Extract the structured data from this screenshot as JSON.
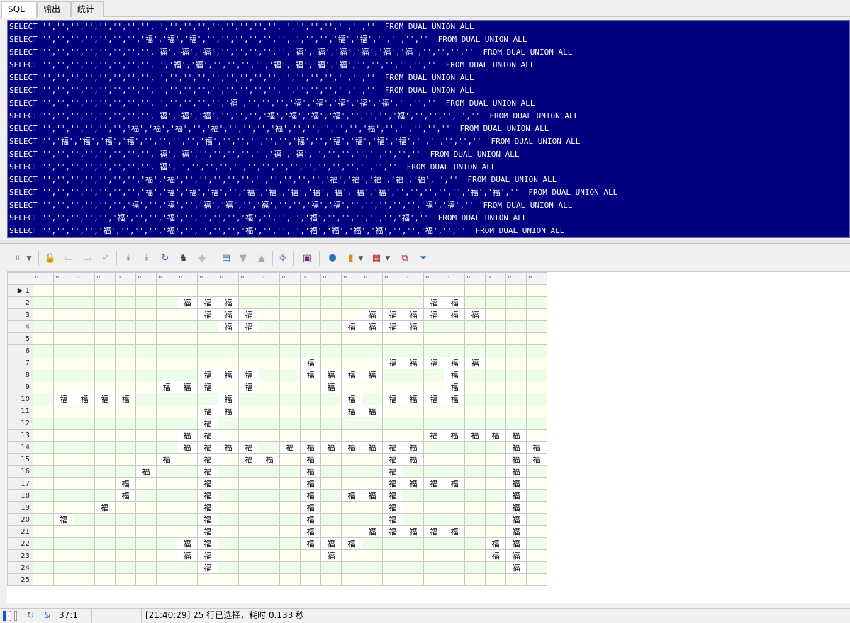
{
  "tabs": [
    {
      "label": "SQL",
      "active": true
    },
    {
      "label": "输出",
      "active": false
    },
    {
      "label": "统计",
      "active": false
    }
  ],
  "sql_lines": [
    "SELECT '','','','','','','','','','','','','','','','','','','','','','','',''  FROM DUAL UNION ALL",
    "SELECT '','','','','','','','福','福','福','','','','','','','','','','福','福','','','',''  FROM DUAL UNION ALL",
    "SELECT '','','','','','','','','福','福','福','','','','','','福','福','福','福','福','福','','','',''  FROM DUAL UNION ALL",
    "SELECT '','','','','','','','','','福','福','','','','','福','福','福','福','','','','','',''  FROM DUAL UNION ALL",
    "SELECT '','','','','','','','','','','','','','','','','','','','','','','',''  FROM DUAL UNION ALL",
    "SELECT '','','','','','','','','','','','','','','','','','','','','','','',''  FROM DUAL UNION ALL",
    "SELECT '','','','','','','','','','','','','','福','','','','福','福','福','福','福','','',''  FROM DUAL UNION ALL",
    "SELECT '','','','','','','','','福','福','福','','','','福','福','福','福','','','','福','','','','',''  FROM DUAL UNION ALL",
    "SELECT '','','','','','','福','福','福','','福','','','','福','','','','','','福','','','','',''  FROM DUAL UNION ALL",
    "SELECT '','福','福','福','福','','','','','福','','','','','','福','','福','福','福','福','','','','',''  FROM DUAL UNION ALL",
    "SELECT '','','','','','','','','福','福','','','','','','福','福','','','','','','','',''  FROM DUAL UNION ALL",
    "SELECT '','','','','','','','','福','','','','','','','','','','','','','','','',''  FROM DUAL UNION ALL",
    "SELECT '','','','','','','','福','福','','','','','','','','','','','福','福','福','福','福','',''  FROM DUAL UNION ALL",
    "SELECT '','','','','','','','福','福','福','福','','福','福','福','福','福','福','福','','','','','','福','福',''  FROM DUAL UNION ALL",
    "SELECT '','','','','','','福','','福','','福','福','','福','','','福','福','','','','','','福','福',''  FROM DUAL UNION ALL",
    "SELECT '','','','','','福','','','福','','','','','福','','','','福','','','','','','福',''  FROM DUAL UNION ALL",
    "SELECT '','','','','福','','','','福','','','','','福','','','','福','福','福','福','','','福','',''  FROM DUAL UNION ALL"
  ],
  "grid": {
    "col_count": 25,
    "col_header": "''",
    "rows": [
      [],
      [
        7,
        8,
        9,
        19,
        20
      ],
      [
        8,
        9,
        10,
        16,
        17,
        18,
        19,
        20,
        21
      ],
      [
        9,
        10,
        15,
        16,
        17,
        18
      ],
      [],
      [],
      [
        13,
        17,
        18,
        19,
        20,
        21
      ],
      [
        8,
        9,
        10,
        13,
        14,
        15,
        16,
        20
      ],
      [
        6,
        7,
        8,
        10,
        14,
        20
      ],
      [
        1,
        2,
        3,
        4,
        9,
        15,
        17,
        18,
        19,
        20
      ],
      [
        8,
        9,
        15,
        16
      ],
      [
        8
      ],
      [
        7,
        8,
        19,
        20,
        21,
        22,
        23
      ],
      [
        7,
        8,
        9,
        10,
        12,
        13,
        14,
        15,
        16,
        17,
        18,
        23,
        24
      ],
      [
        6,
        8,
        10,
        11,
        13,
        17,
        18,
        23,
        24
      ],
      [
        5,
        8,
        13,
        17,
        23
      ],
      [
        4,
        8,
        13,
        17,
        18,
        19,
        20,
        23
      ],
      [
        4,
        8,
        13,
        15,
        16,
        17,
        23
      ],
      [
        3,
        8,
        13,
        17,
        23
      ],
      [
        1,
        8,
        13,
        17,
        23
      ],
      [
        8,
        13,
        16,
        17,
        18,
        19,
        20,
        23
      ],
      [
        7,
        8,
        13,
        14,
        15,
        22,
        23
      ],
      [
        7,
        8,
        14,
        22,
        23
      ],
      [
        8,
        23
      ],
      []
    ],
    "char": "福"
  },
  "status": {
    "cursor": "37:1",
    "message": "[21:40:29]  25 行已选择，耗时 0.133 秒"
  }
}
